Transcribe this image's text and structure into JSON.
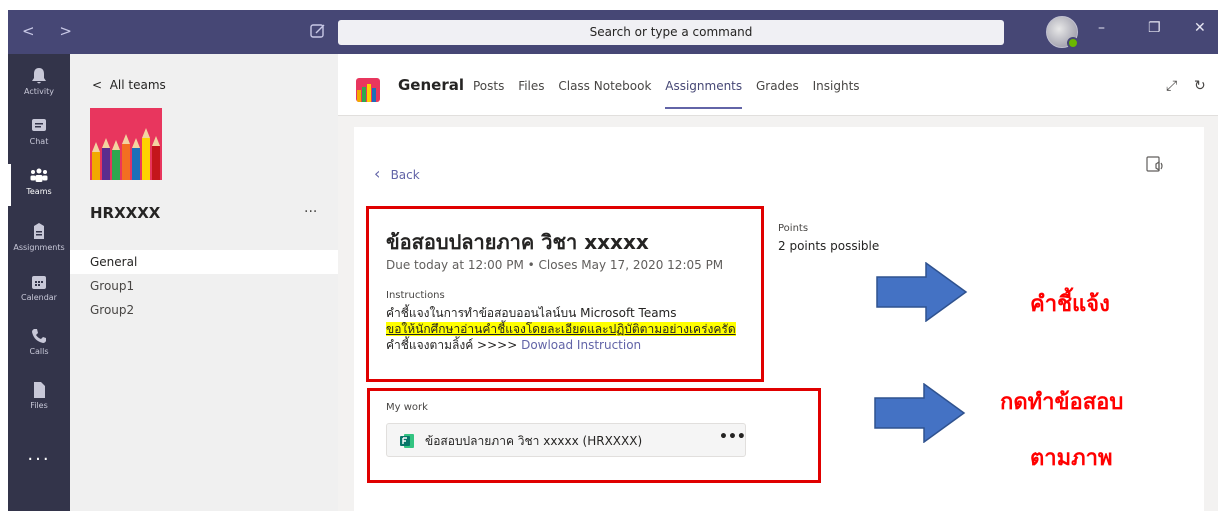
{
  "titlebar": {
    "nav": "< >",
    "search_placeholder": "Search or type a command",
    "win_min": "–",
    "win_max": "❐",
    "win_close": "✕"
  },
  "rail": {
    "items": [
      {
        "label": "Activity",
        "icon": "bell-icon"
      },
      {
        "label": "Chat",
        "icon": "chat-icon"
      },
      {
        "label": "Teams",
        "icon": "teams-icon"
      },
      {
        "label": "Assignments",
        "icon": "assignments-icon"
      },
      {
        "label": "Calendar",
        "icon": "calendar-icon"
      },
      {
        "label": "Calls",
        "icon": "phone-icon"
      },
      {
        "label": "Files",
        "icon": "file-icon"
      }
    ],
    "more": "..."
  },
  "teampanel": {
    "back_label": "All teams",
    "team_name": "HRXXXX",
    "more": "...",
    "channels": [
      "General",
      "Group1",
      "Group2"
    ]
  },
  "channel_header": {
    "name": "General",
    "tabs": [
      "Posts",
      "Files",
      "Class Notebook",
      "Assignments",
      "Grades",
      "Insights"
    ],
    "active_tab": "Assignments"
  },
  "assignment": {
    "back_label": "Back",
    "title": "ข้อสอบปลายภาค วิชา xxxxx",
    "due": "Due today at 12:00 PM   •   Closes May 17, 2020 12:05 PM",
    "instructions_label": "Instructions",
    "instructions_line1": "คำชี้แจงในการทำข้อสอบออนไลน์บน Microsoft Teams",
    "instructions_highlight": "ขอให้นักศึกษาอ่านคำชี้แจงโดยละเอียดและปฏิบัติตามอย่างเคร่งครัด",
    "instructions_line3_prefix": "คำชี้แจงตามลิ้งค์ >>>> ",
    "instructions_link": "Dowload Instruction",
    "points_label": "Points",
    "points_value": "2 points possible",
    "my_work_label": "My work",
    "file_name": "ข้อสอบปลายภาค วิชา xxxxx (HRXXXX)",
    "file_more": "•••"
  },
  "callouts": {
    "instructions": "คำชี้แจ้ง",
    "do_exam": "กดทำข้อสอบ",
    "as_shown": "ตามภาพ"
  },
  "colors": {
    "titlebar": "#464775",
    "rail": "#33344a",
    "accent": "#6264a7",
    "annotation_red": "#e00000",
    "arrow_blue": "#4472c4",
    "highlight": "#ffff00"
  }
}
